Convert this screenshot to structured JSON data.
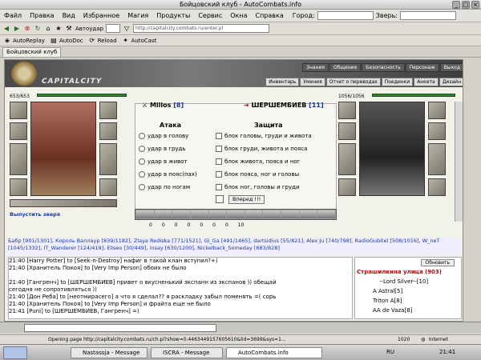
{
  "window": {
    "title": "Бойцовский клуб - AutoCombats.info"
  },
  "menu": {
    "items": [
      "Файл",
      "Правка",
      "Вид",
      "Избранное",
      "Магия",
      "Продукты",
      "Сервис",
      "Окна",
      "Справка"
    ],
    "city_label": "Город:",
    "beast_label": "Зверь:"
  },
  "toolbar": {
    "autoudar": "Автоудар",
    "address": "http://capitalcity.combats.ru/enter.pl"
  },
  "toolbar2": {
    "buttons": [
      "AutoReplay",
      "AutoDoc",
      "Reload",
      "AutoCast"
    ]
  },
  "tab": {
    "label": "Бойцовский клуб"
  },
  "game": {
    "logo": "CAPITALCITY",
    "topnav": [
      "Знания",
      "Общение",
      "Безопасность",
      "Персонаж",
      "Выход"
    ],
    "subnav": [
      "Инвентарь",
      "Умения",
      "Отчет о переводах",
      "Поединки",
      "Анкета",
      "Дизайн"
    ],
    "left": {
      "hp": "653/653",
      "name": "Millos",
      "level": "[8]"
    },
    "right": {
      "hp": "1056/1056",
      "name": "ШЕРШЕМБИЕВ",
      "level": "[11]"
    },
    "attack_title": "Атака",
    "defense_title": "Защита",
    "attacks": [
      "удар в голову",
      "удар в грудь",
      "удар в живот",
      "удар в пояс(пах)",
      "удар по ногам"
    ],
    "defenses": [
      "блок головы, груди и живота",
      "блок груди, живота и пояса",
      "блок живота, пояса и ног",
      "блок пояса, ног и головы",
      "блок ног, головы и груди"
    ],
    "forward_btn": "Вперед !!!",
    "stats": [
      "0",
      "0",
      "0",
      "0",
      "0",
      "0",
      "0",
      "10"
    ],
    "release_beast": "Выпустить зверя",
    "players": "Бабр [901/1301], Король Валлаур [839/1182], Zlaya Rediska [771/1521], Gi_Ga [491/1465], dartsidius [55/821], Alex Ju [740/798], RadioGubitel [508/1016], W_neT [1045/1332], IT_Wanderer [124/419], Eliseo [30/449], insay [630/1200], Nickelback_Someday [683/828]",
    "chat": [
      {
        "t": "21:40",
        "txt": "[Harry Potter] to [Seek-n-Destroy] нафиг в такой клан вступил?+)"
      },
      {
        "t": "21:40",
        "txt": "[Хранитель Покоя] to [Very Imp Person] обоих не было"
      },
      {
        "t": "",
        "txt": ""
      },
      {
        "t": "21:40",
        "txt": "[Гангренч] to [ШЕРШЕМБИЕВ] привет о вкусненький экспанн из экспанов )) обещай"
      },
      {
        "t": "",
        "txt": "сегодня не сопротивляться ))"
      },
      {
        "t": "21:40",
        "txt": "[Дон Реба] to [неотмирасего] а что я сделал?? я раскладку забыл поменять =( сорь"
      },
      {
        "t": "21:40",
        "txt": "[Хранитель Покоя] to [Very Imp Person] и фрайта еще не было"
      },
      {
        "t": "21:41",
        "txt": "[Puni] to [ШЕРШЕМБИЕВ, Гангренч] =)"
      }
    ],
    "refresh_btn": "Обновить",
    "street_title": "Страшилкина улица (903)",
    "street_users": [
      "--Lord Silver--[10]",
      "A Astral[5]",
      "Triton A[8]",
      "AA de Vaza[8]"
    ]
  },
  "status": {
    "text": "Opening page http://capitalcity.combats.ru/ch.pl?show=0.4463449157605610&lid=3699&sys=1...",
    "zone": "Internet",
    "num": "1020"
  },
  "taskbar": {
    "tasks": [
      "Nastassja - Message",
      "ISCRA - Message",
      "AutoCombats.info"
    ],
    "lang": "RU",
    "clock": "21:41"
  },
  "colors": {
    "accent": "#2a8a2a",
    "link": "#1a3aa0"
  }
}
